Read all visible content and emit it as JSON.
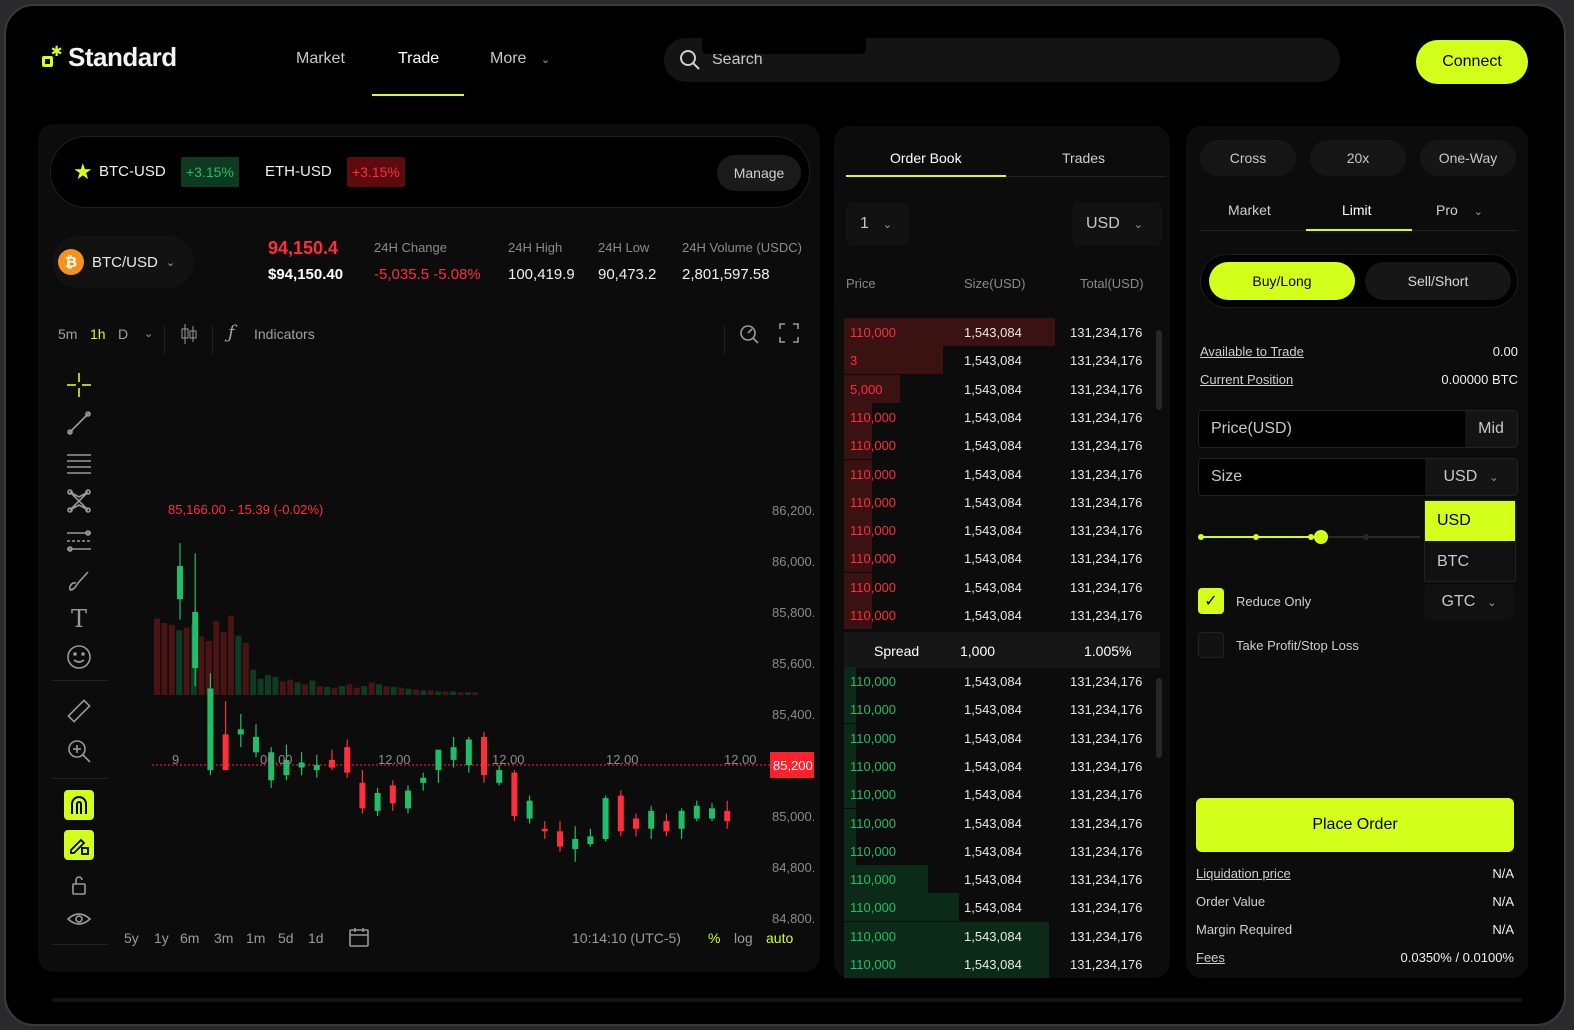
{
  "header": {
    "logo": "Standard",
    "nav": [
      {
        "label": "Market"
      },
      {
        "label": "Trade"
      },
      {
        "label": "More"
      }
    ],
    "search_placeholder": "Search",
    "connect_label": "Connect"
  },
  "tickers": [
    {
      "symbol": "BTC-USD",
      "change": "+3.15%",
      "dir": "up"
    },
    {
      "symbol": "ETH-USD",
      "change": "+3.15%",
      "dir": "down"
    }
  ],
  "manage_label": "Manage",
  "pair": {
    "coin_glyph": "₿",
    "label": "BTC/USD"
  },
  "stats": {
    "last_price": "94,150.4",
    "mark_price": "$94,150.40",
    "change_label": "24H Change",
    "change_value": "-5,035.5 -5.08%",
    "high_label": "24H High",
    "high_value": "100,419.9",
    "low_label": "24H Low",
    "low_value": "90,473.2",
    "volume_label": "24H Volume (USDC)",
    "volume_value": "2,801,597.58"
  },
  "toolbar": {
    "intervals": [
      "5m",
      "1h",
      "D"
    ],
    "active_interval": "1h",
    "indicators_label": "Indicators"
  },
  "chart_data": {
    "type": "candlestick",
    "legend": "85,166.00 - 15.39 (-0.02%)",
    "y_ticks": [
      "86,200.00",
      "86,000.00",
      "85,800.00",
      "85,600.00",
      "85,400.00",
      "85,200.00",
      "85,000.00",
      "84,800.00",
      "84,800.00"
    ],
    "y_tick_values": [
      86200,
      86000,
      85800,
      85600,
      85400,
      85200,
      85000,
      84800,
      84600
    ],
    "ylim": [
      84600,
      86200
    ],
    "x_ticks": [
      "9",
      "06.00",
      "12.00",
      "12.00",
      "12.00",
      "12.00"
    ],
    "current_price": "85,200.00",
    "current_value": 85200,
    "candles": [
      {
        "o": 85850,
        "h": 86070,
        "l": 85770,
        "c": 85980
      },
      {
        "o": 85580,
        "h": 86030,
        "l": 85510,
        "c": 85800
      },
      {
        "o": 85180,
        "h": 85560,
        "l": 85160,
        "c": 85500
      },
      {
        "o": 85320,
        "h": 85450,
        "l": 85190,
        "c": 85180
      },
      {
        "o": 85320,
        "h": 85400,
        "l": 85270,
        "c": 85340
      },
      {
        "o": 85250,
        "h": 85360,
        "l": 85230,
        "c": 85310
      },
      {
        "o": 85140,
        "h": 85270,
        "l": 85110,
        "c": 85250
      },
      {
        "o": 85160,
        "h": 85280,
        "l": 85140,
        "c": 85220
      },
      {
        "o": 85190,
        "h": 85250,
        "l": 85160,
        "c": 85210
      },
      {
        "o": 85180,
        "h": 85240,
        "l": 85150,
        "c": 85200
      },
      {
        "o": 85220,
        "h": 85260,
        "l": 85180,
        "c": 85190
      },
      {
        "o": 85270,
        "h": 85300,
        "l": 85150,
        "c": 85170
      },
      {
        "o": 85130,
        "h": 85180,
        "l": 85010,
        "c": 85030
      },
      {
        "o": 85020,
        "h": 85110,
        "l": 85000,
        "c": 85090
      },
      {
        "o": 85120,
        "h": 85140,
        "l": 85020,
        "c": 85050
      },
      {
        "o": 85030,
        "h": 85120,
        "l": 85010,
        "c": 85100
      },
      {
        "o": 85130,
        "h": 85170,
        "l": 85100,
        "c": 85150
      },
      {
        "o": 85180,
        "h": 85260,
        "l": 85130,
        "c": 85260
      },
      {
        "o": 85220,
        "h": 85310,
        "l": 85190,
        "c": 85270
      },
      {
        "o": 85200,
        "h": 85310,
        "l": 85170,
        "c": 85300
      },
      {
        "o": 85310,
        "h": 85330,
        "l": 85130,
        "c": 85160
      },
      {
        "o": 85130,
        "h": 85200,
        "l": 85120,
        "c": 85180
      },
      {
        "o": 85170,
        "h": 85180,
        "l": 84980,
        "c": 85000
      },
      {
        "o": 84990,
        "h": 85080,
        "l": 84970,
        "c": 85060
      },
      {
        "o": 84950,
        "h": 84980,
        "l": 84910,
        "c": 84940
      },
      {
        "o": 84940,
        "h": 84980,
        "l": 84860,
        "c": 84880
      },
      {
        "o": 84870,
        "h": 84960,
        "l": 84820,
        "c": 84910
      },
      {
        "o": 84890,
        "h": 84950,
        "l": 84880,
        "c": 84920
      },
      {
        "o": 84910,
        "h": 85080,
        "l": 84900,
        "c": 85070
      },
      {
        "o": 85080,
        "h": 85100,
        "l": 84920,
        "c": 84940
      },
      {
        "o": 84990,
        "h": 85010,
        "l": 84920,
        "c": 84950
      },
      {
        "o": 84950,
        "h": 85040,
        "l": 84910,
        "c": 85020
      },
      {
        "o": 84980,
        "h": 85010,
        "l": 84920,
        "c": 84940
      },
      {
        "o": 84950,
        "h": 85030,
        "l": 84910,
        "c": 85020
      },
      {
        "o": 84990,
        "h": 85060,
        "l": 84980,
        "c": 85040
      },
      {
        "o": 84990,
        "h": 85050,
        "l": 84980,
        "c": 85030
      },
      {
        "o": 85020,
        "h": 85060,
        "l": 84950,
        "c": 84980
      }
    ],
    "volumes": [
      0.85,
      0.8,
      0.78,
      0.72,
      0.75,
      0.78,
      0.65,
      0.6,
      0.82,
      0.7,
      0.88,
      0.66,
      0.58,
      0.28,
      0.18,
      0.22,
      0.2,
      0.15,
      0.17,
      0.14,
      0.12,
      0.16,
      0.1,
      0.09,
      0.08,
      0.1,
      0.12,
      0.08,
      0.1,
      0.14,
      0.12,
      0.1,
      0.09,
      0.08,
      0.07,
      0.06,
      0.05,
      0.05,
      0.04,
      0.04,
      0.04,
      0.03,
      0.03,
      0.03
    ],
    "volume_dirs": [
      "d",
      "d",
      "d",
      "u",
      "d",
      "u",
      "d",
      "d",
      "d",
      "d",
      "d",
      "u",
      "d",
      "u",
      "u",
      "u",
      "u",
      "d",
      "d",
      "u",
      "d",
      "u",
      "d",
      "u",
      "d",
      "u",
      "d",
      "d",
      "u",
      "d",
      "u",
      "d",
      "u",
      "d",
      "u",
      "d",
      "u",
      "d",
      "u",
      "d",
      "u",
      "d",
      "u",
      "d"
    ]
  },
  "bottom_bar": {
    "ranges": [
      "5y",
      "1y",
      "6m",
      "3m",
      "1m",
      "5d",
      "1d"
    ],
    "time": "10:14:10 (UTC-5)",
    "pct": "%",
    "log": "log",
    "auto": "auto"
  },
  "orderbook": {
    "tabs": [
      "Order Book",
      "Trades"
    ],
    "grouping": "1",
    "currency": "USD",
    "headers": [
      "Price",
      "Size(USD)",
      "Total(USD)"
    ],
    "asks": [
      {
        "price": "110,000",
        "size": "1,543,084",
        "total": "131,234,176",
        "depth": 0.68
      },
      {
        "price": "3",
        "size": "1,543,084",
        "total": "131,234,176",
        "depth": 0.32
      },
      {
        "price": "5,000",
        "size": "1,543,084",
        "total": "131,234,176",
        "depth": 0.18
      },
      {
        "price": "110,000",
        "size": "1,543,084",
        "total": "131,234,176",
        "depth": 0.09
      },
      {
        "price": "110,000",
        "size": "1,543,084",
        "total": "131,234,176",
        "depth": 0.09
      },
      {
        "price": "110,000",
        "size": "1,543,084",
        "total": "131,234,176",
        "depth": 0.09
      },
      {
        "price": "110,000",
        "size": "1,543,084",
        "total": "131,234,176",
        "depth": 0.09
      },
      {
        "price": "110,000",
        "size": "1,543,084",
        "total": "131,234,176",
        "depth": 0.09
      },
      {
        "price": "110,000",
        "size": "1,543,084",
        "total": "131,234,176",
        "depth": 0.09
      },
      {
        "price": "110,000",
        "size": "1,543,084",
        "total": "131,234,176",
        "depth": 0.09
      },
      {
        "price": "110,000",
        "size": "1,543,084",
        "total": "131,234,176",
        "depth": 0.09
      }
    ],
    "spread": {
      "label": "Spread",
      "value": "1,000",
      "pct": "1.005%"
    },
    "bids": [
      {
        "price": "110,000",
        "size": "1,543,084",
        "total": "131,234,176",
        "depth": 0.04
      },
      {
        "price": "110,000",
        "size": "1,543,084",
        "total": "131,234,176",
        "depth": 0.04
      },
      {
        "price": "110,000",
        "size": "1,543,084",
        "total": "131,234,176",
        "depth": 0.04
      },
      {
        "price": "110,000",
        "size": "1,543,084",
        "total": "131,234,176",
        "depth": 0.04
      },
      {
        "price": "110,000",
        "size": "1,543,084",
        "total": "131,234,176",
        "depth": 0.04
      },
      {
        "price": "110,000",
        "size": "1,543,084",
        "total": "131,234,176",
        "depth": 0.04
      },
      {
        "price": "110,000",
        "size": "1,543,084",
        "total": "131,234,176",
        "depth": 0.04
      },
      {
        "price": "110,000",
        "size": "1,543,084",
        "total": "131,234,176",
        "depth": 0.27
      },
      {
        "price": "110,000",
        "size": "1,543,084",
        "total": "131,234,176",
        "depth": 0.37
      },
      {
        "price": "110,000",
        "size": "1,543,084",
        "total": "131,234,176",
        "depth": 0.66
      },
      {
        "price": "110,000",
        "size": "1,543,084",
        "total": "131,234,176",
        "depth": 0.66
      }
    ]
  },
  "trade": {
    "margin_mode": "Cross",
    "leverage": "20x",
    "position_mode": "One-Way",
    "order_tabs": [
      "Market",
      "Limit",
      "Pro"
    ],
    "active_order_tab": "Limit",
    "buy_label": "Buy/Long",
    "sell_label": "Sell/Short",
    "available_label": "Available to Trade",
    "available_value": "0.00",
    "position_label": "Current Position",
    "position_value": "0.00000 BTC",
    "price_placeholder": "Price(USD)",
    "mid_label": "Mid",
    "size_placeholder": "Size",
    "size_unit": "USD",
    "unit_options": [
      "USD",
      "BTC"
    ],
    "slider_fraction": 0.55,
    "reduce_only_label": "Reduce Only",
    "reduce_only": true,
    "tpsl_label": "Take Profit/Stop Loss",
    "tpsl": false,
    "tif": "GTC",
    "place_label": "Place Order",
    "summary": [
      {
        "label": "Liquidation price",
        "value": "N/A",
        "underline": true
      },
      {
        "label": "Order Value",
        "value": "N/A",
        "underline": false
      },
      {
        "label": "Margin Required",
        "value": "N/A",
        "underline": false
      },
      {
        "label": "Fees",
        "value": "0.0350% / 0.0100%",
        "underline": true
      }
    ]
  },
  "colors": {
    "accent": "#d4ff1a",
    "up": "#1fbf6a",
    "down": "#ff2e3c"
  }
}
